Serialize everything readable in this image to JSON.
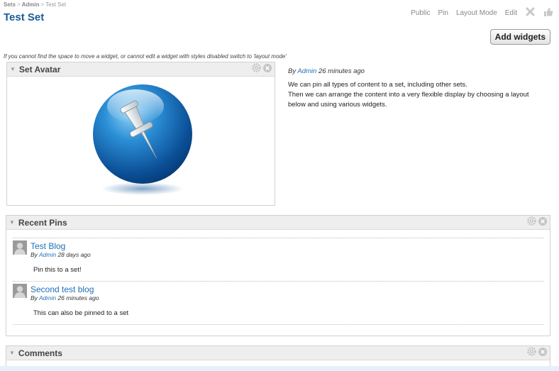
{
  "breadcrumb": {
    "items": [
      "Sets",
      "Admin",
      "Test Set"
    ],
    "separator": ">"
  },
  "page": {
    "title": "Test Set"
  },
  "top_actions": {
    "public": "Public",
    "pin": "Pin",
    "layout_mode": "Layout Mode",
    "edit": "Edit",
    "delete_icon": "close-x-icon",
    "like_icon": "thumbs-up-icon"
  },
  "toolbar": {
    "add_widgets": "Add widgets"
  },
  "layout_hint": "If you cannot find the space to move a widget, or cannot edit a widget with styles disabled switch to 'layout mode'",
  "avatar_widget": {
    "title": "Set Avatar",
    "image_icon": "pushpin-globe-icon"
  },
  "set_info": {
    "by": "By",
    "author": "Admin",
    "time": "26 minutes ago",
    "desc1": "We can pin all types of content to a set, including other sets.",
    "desc2": "Then we can arrange the content into a very flexible display by choosing a layout below and using various widgets."
  },
  "recent_pins": {
    "title": "Recent Pins",
    "items": [
      {
        "title": "Test Blog",
        "by": "By",
        "author": "Admin",
        "time": "28 days ago",
        "text": "Pin this to a set!"
      },
      {
        "title": "Second test blog",
        "by": "By",
        "author": "Admin",
        "time": "26 minutes ago",
        "text": "This can also be pinned to a set"
      }
    ]
  },
  "comments": {
    "title": "Comments"
  },
  "colors": {
    "title_blue": "#1a5d99",
    "link_blue": "#1f6fb7",
    "header_gray": "#eeeeee"
  }
}
